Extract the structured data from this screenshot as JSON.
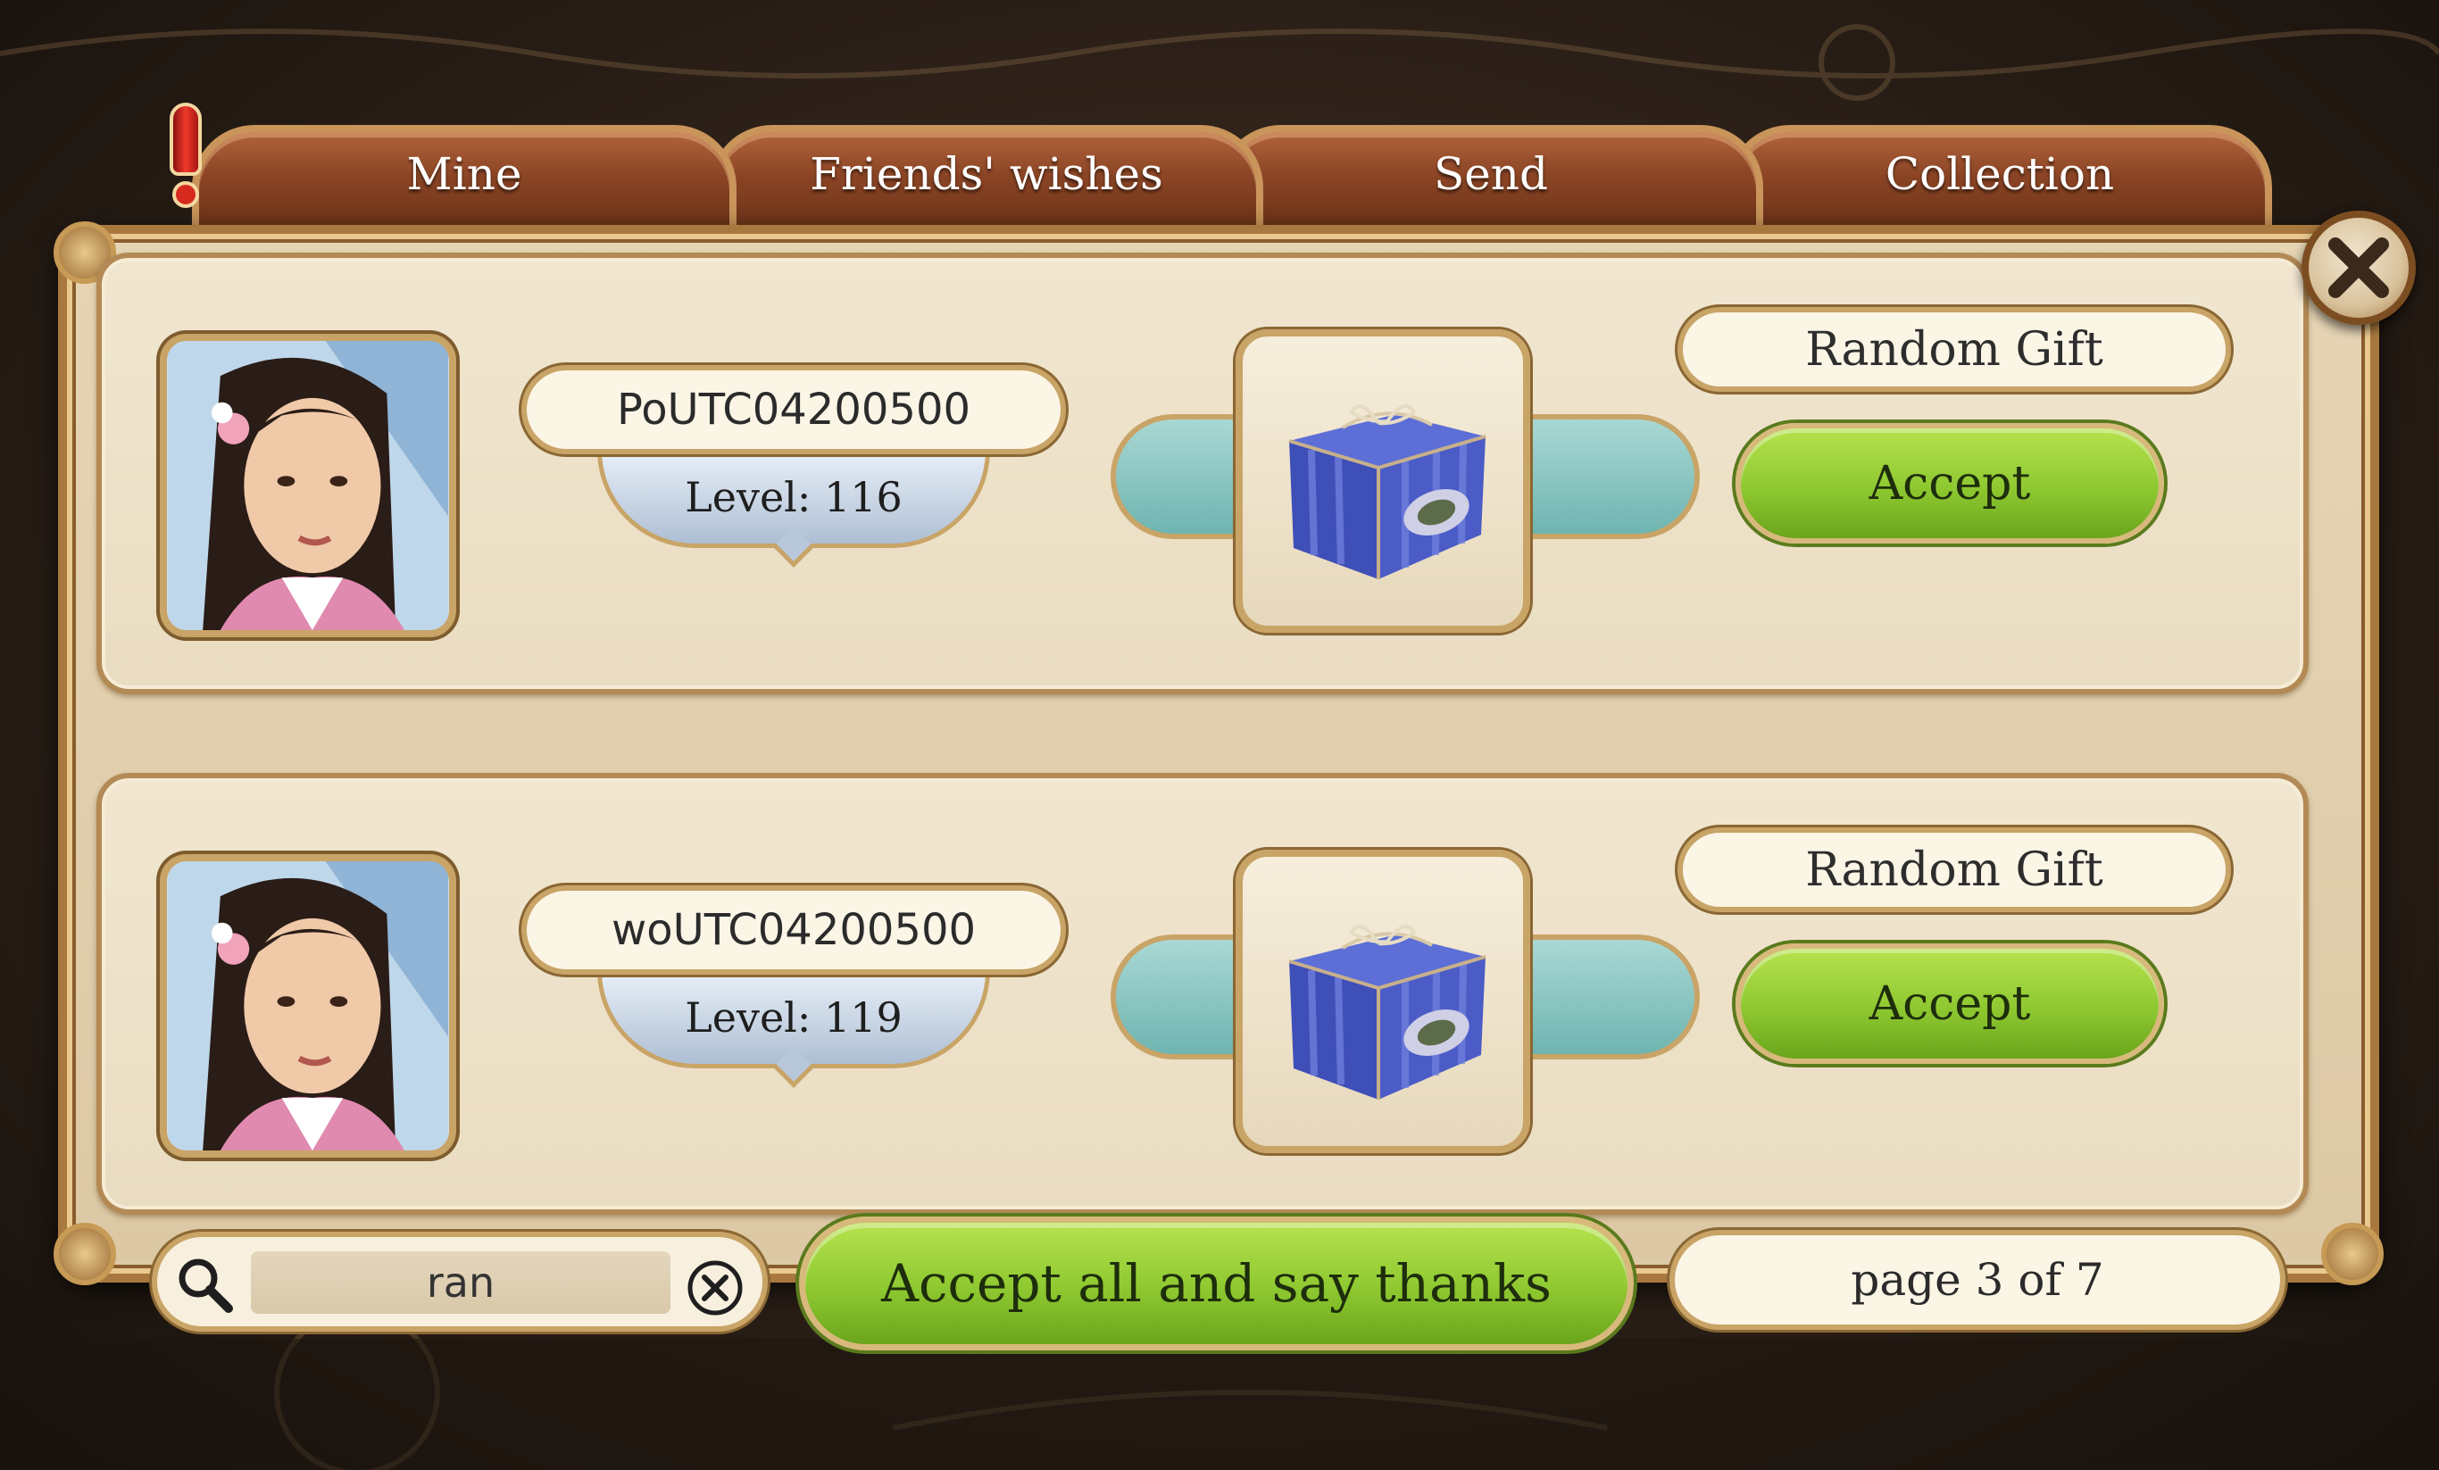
{
  "tabs": [
    {
      "label": "Mine",
      "active": true,
      "has_alert": true
    },
    {
      "label": "Friends' wishes",
      "active": false
    },
    {
      "label": "Send",
      "active": false
    },
    {
      "label": "Collection",
      "active": false
    }
  ],
  "gifts": [
    {
      "sender_name": "PoUTC04200500",
      "level_text": "Level: 116",
      "gift_type": "Random Gift",
      "accept_label": "Accept",
      "avatar_icon": "player-avatar-portrait",
      "gift_icon": "blue-gift-box-icon"
    },
    {
      "sender_name": "woUTC04200500",
      "level_text": "Level: 119",
      "gift_type": "Random Gift",
      "accept_label": "Accept",
      "avatar_icon": "player-avatar-portrait",
      "gift_icon": "blue-gift-box-icon"
    }
  ],
  "search": {
    "value": "ran"
  },
  "accept_all_label": "Accept all and say thanks",
  "pagination": {
    "text": "page 3 of 7"
  },
  "colors": {
    "tab_brown": "#8a4424",
    "accept_green": "#8ec830",
    "frame_gold": "#c9a467",
    "panel_cream": "#f1e6d0"
  }
}
